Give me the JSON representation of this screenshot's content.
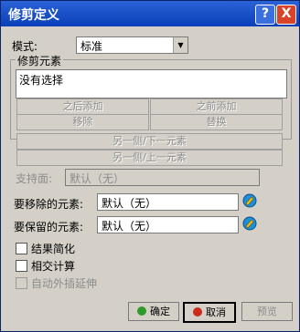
{
  "window": {
    "title": "修剪定义",
    "help_symbol": "?",
    "close_symbol": "X"
  },
  "mode": {
    "label": "模式:",
    "value": "标准"
  },
  "trim_elements": {
    "group_label": "修剪元素",
    "list_text": "没有选择",
    "buttons": {
      "add_after": "之后添加",
      "add_before": "之前添加",
      "remove": "移除",
      "replace": "替换",
      "other_side_next": "另一侧/下一元素",
      "other_side_prev": "另一侧/上一元素"
    }
  },
  "support": {
    "label": "支持面:",
    "value": "默认（无）"
  },
  "remove_elements": {
    "label": "要移除的元素:",
    "value": "默认（无）",
    "icon": "selection-icon"
  },
  "keep_elements": {
    "label": "要保留的元素:",
    "value": "默认（无）",
    "icon": "selection-icon"
  },
  "options": {
    "simplify_result": "结果简化",
    "intersection_compute": "相交计算",
    "auto_extrapolate": "自动外插延伸"
  },
  "footer": {
    "ok": "确定",
    "cancel": "取消",
    "preview": "预览"
  },
  "colors": {
    "title_bar": "#0a3fb8",
    "ok_dot": "#2e9a2e",
    "cancel_dot": "#cc2a1a"
  }
}
